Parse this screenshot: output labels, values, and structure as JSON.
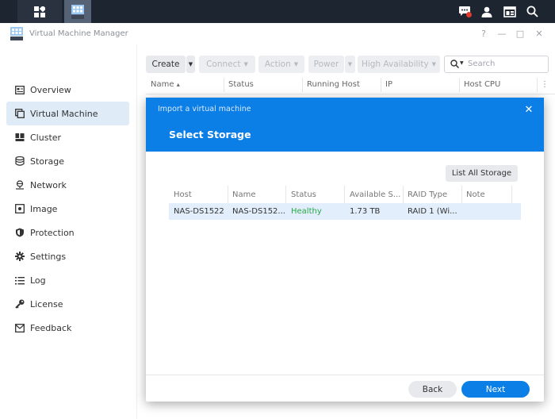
{
  "window": {
    "title": "Virtual Machine Manager",
    "controls": {
      "help": "?",
      "minimize": "—",
      "maximize": "□",
      "close": "✕"
    }
  },
  "sidebar": {
    "items": [
      {
        "label": "Overview",
        "icon": "overview-icon",
        "active": false
      },
      {
        "label": "Virtual Machine",
        "icon": "vm-icon",
        "active": true
      },
      {
        "label": "Cluster",
        "icon": "cluster-icon",
        "active": false
      },
      {
        "label": "Storage",
        "icon": "storage-icon",
        "active": false
      },
      {
        "label": "Network",
        "icon": "network-icon",
        "active": false
      },
      {
        "label": "Image",
        "icon": "image-icon",
        "active": false
      },
      {
        "label": "Protection",
        "icon": "shield-icon",
        "active": false
      },
      {
        "label": "Settings",
        "icon": "gear-icon",
        "active": false
      },
      {
        "label": "Log",
        "icon": "list-icon",
        "active": false
      },
      {
        "label": "License",
        "icon": "key-icon",
        "active": false
      },
      {
        "label": "Feedback",
        "icon": "mail-icon",
        "active": false
      }
    ]
  },
  "toolbar": {
    "create": "Create",
    "connect": "Connect",
    "action": "Action",
    "power": "Power",
    "high_availability": "High Availability",
    "search_placeholder": "Search"
  },
  "vm_table": {
    "columns": [
      "Name",
      "Status",
      "Running Host",
      "IP",
      "Host CPU"
    ],
    "sort_indicator": "▴"
  },
  "modal": {
    "subtitle": "Import a virtual machine",
    "title": "Select Storage",
    "close": "✕",
    "list_all_storage": "List All Storage",
    "columns": [
      "Host",
      "Name",
      "Status",
      "Available S...",
      "RAID Type",
      "Note"
    ],
    "rows": [
      {
        "host": "NAS-DS1522",
        "name": "NAS-DS152...",
        "status": "Healthy",
        "available": "1.73 TB",
        "raid": "RAID 1 (Wi...",
        "note": ""
      }
    ],
    "back": "Back",
    "next": "Next"
  },
  "colors": {
    "accent": "#0b7fe6",
    "healthy": "#28a745",
    "sidebar_active": "#dfebf7",
    "taskbar": "#1d2530"
  }
}
